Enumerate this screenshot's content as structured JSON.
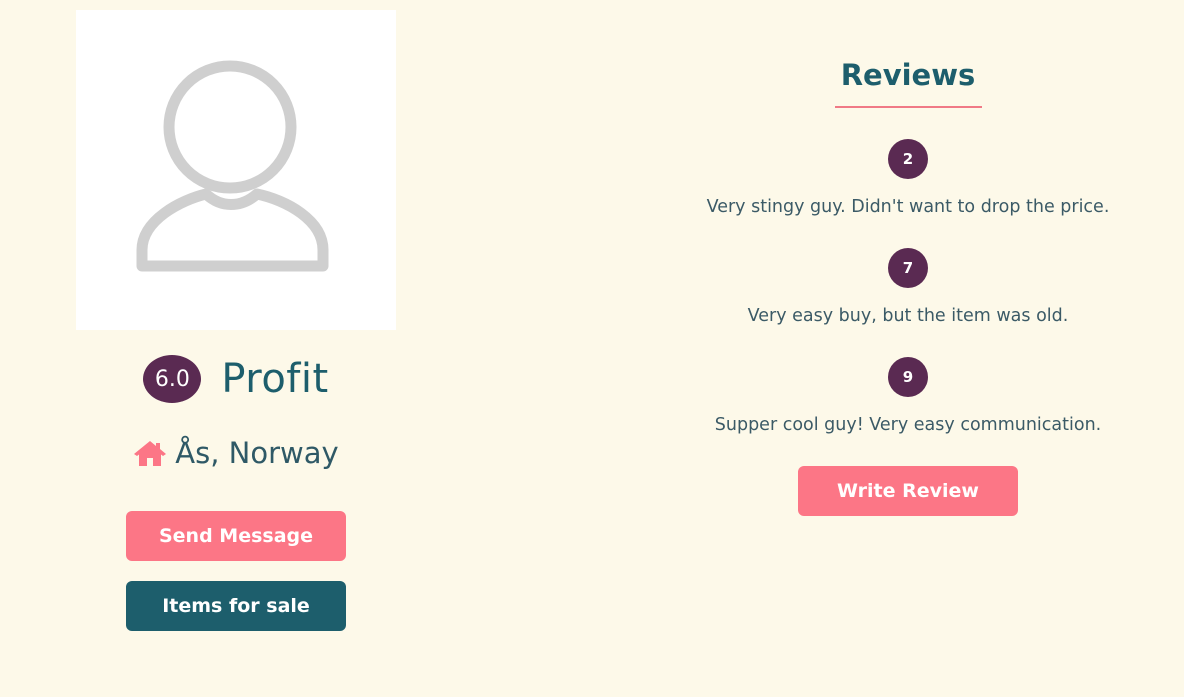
{
  "profile": {
    "avatar_icon": "user-silhouette-icon",
    "rating": "6.0",
    "name": "Profit",
    "location_icon": "home-icon",
    "location": "Ås, Norway",
    "send_message_label": "Send Message",
    "items_for_sale_label": "Items for sale"
  },
  "reviews": {
    "title": "Reviews",
    "items": [
      {
        "score": "2",
        "text": "Very stingy guy. Didn't want to drop the price."
      },
      {
        "score": "7",
        "text": "Very easy buy, but the item was old."
      },
      {
        "score": "9",
        "text": "Supper cool guy! Very easy communication."
      }
    ],
    "write_review_label": "Write Review"
  },
  "colors": {
    "background": "#fdf9e9",
    "primary_teal": "#1d5e6c",
    "accent_pink": "#fc7686",
    "badge_purple": "#5a2a52"
  }
}
